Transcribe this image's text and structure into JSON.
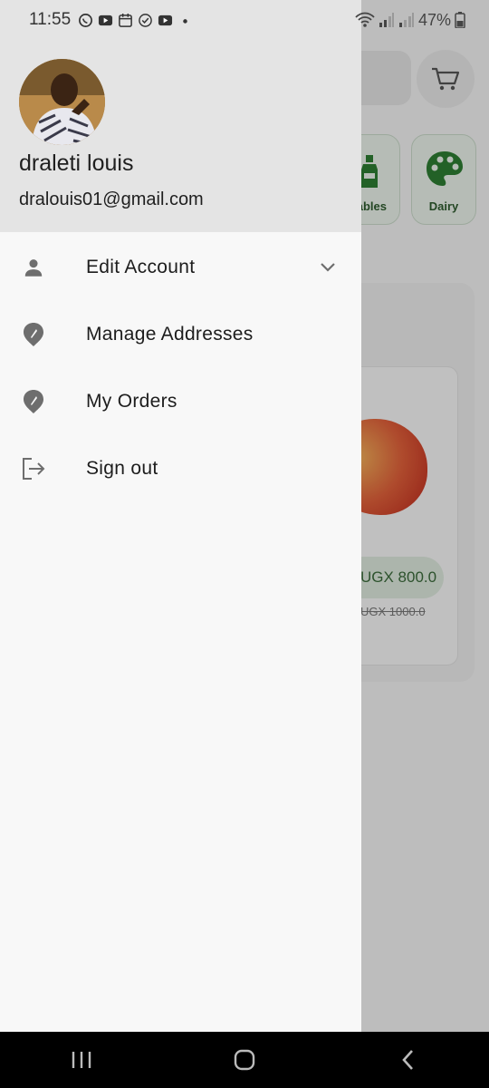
{
  "status_bar": {
    "time": "11:55",
    "battery": "47%",
    "notification_icons": [
      "whatsapp-icon",
      "youtube-icon",
      "calendar-icon",
      "check-circle-icon",
      "youtube-icon",
      "dot-icon"
    ]
  },
  "background": {
    "categories": [
      {
        "label": "ables",
        "icon": "bottle-icon"
      },
      {
        "label": "Dairy",
        "icon": "palette-icon"
      }
    ],
    "product": {
      "price": "UGX 800.0",
      "old_price": "UGX 1000.0"
    }
  },
  "drawer": {
    "user": {
      "name": "draleti louis",
      "email": "dralouis01@gmail.com"
    },
    "menu": [
      {
        "label": "Edit Account",
        "icon": "person-icon",
        "has_chevron": true
      },
      {
        "label": "Manage Addresses",
        "icon": "location-pin-icon",
        "has_chevron": false
      },
      {
        "label": "My Orders",
        "icon": "location-pin-icon",
        "has_chevron": false
      },
      {
        "label": "Sign out",
        "icon": "logout-icon",
        "has_chevron": false
      }
    ]
  },
  "colors": {
    "drawer_header": "#e4e4e4",
    "drawer_body": "#f8f8f8",
    "icon_gray": "#6e6e6e",
    "accent_green": "#2e7d32"
  }
}
